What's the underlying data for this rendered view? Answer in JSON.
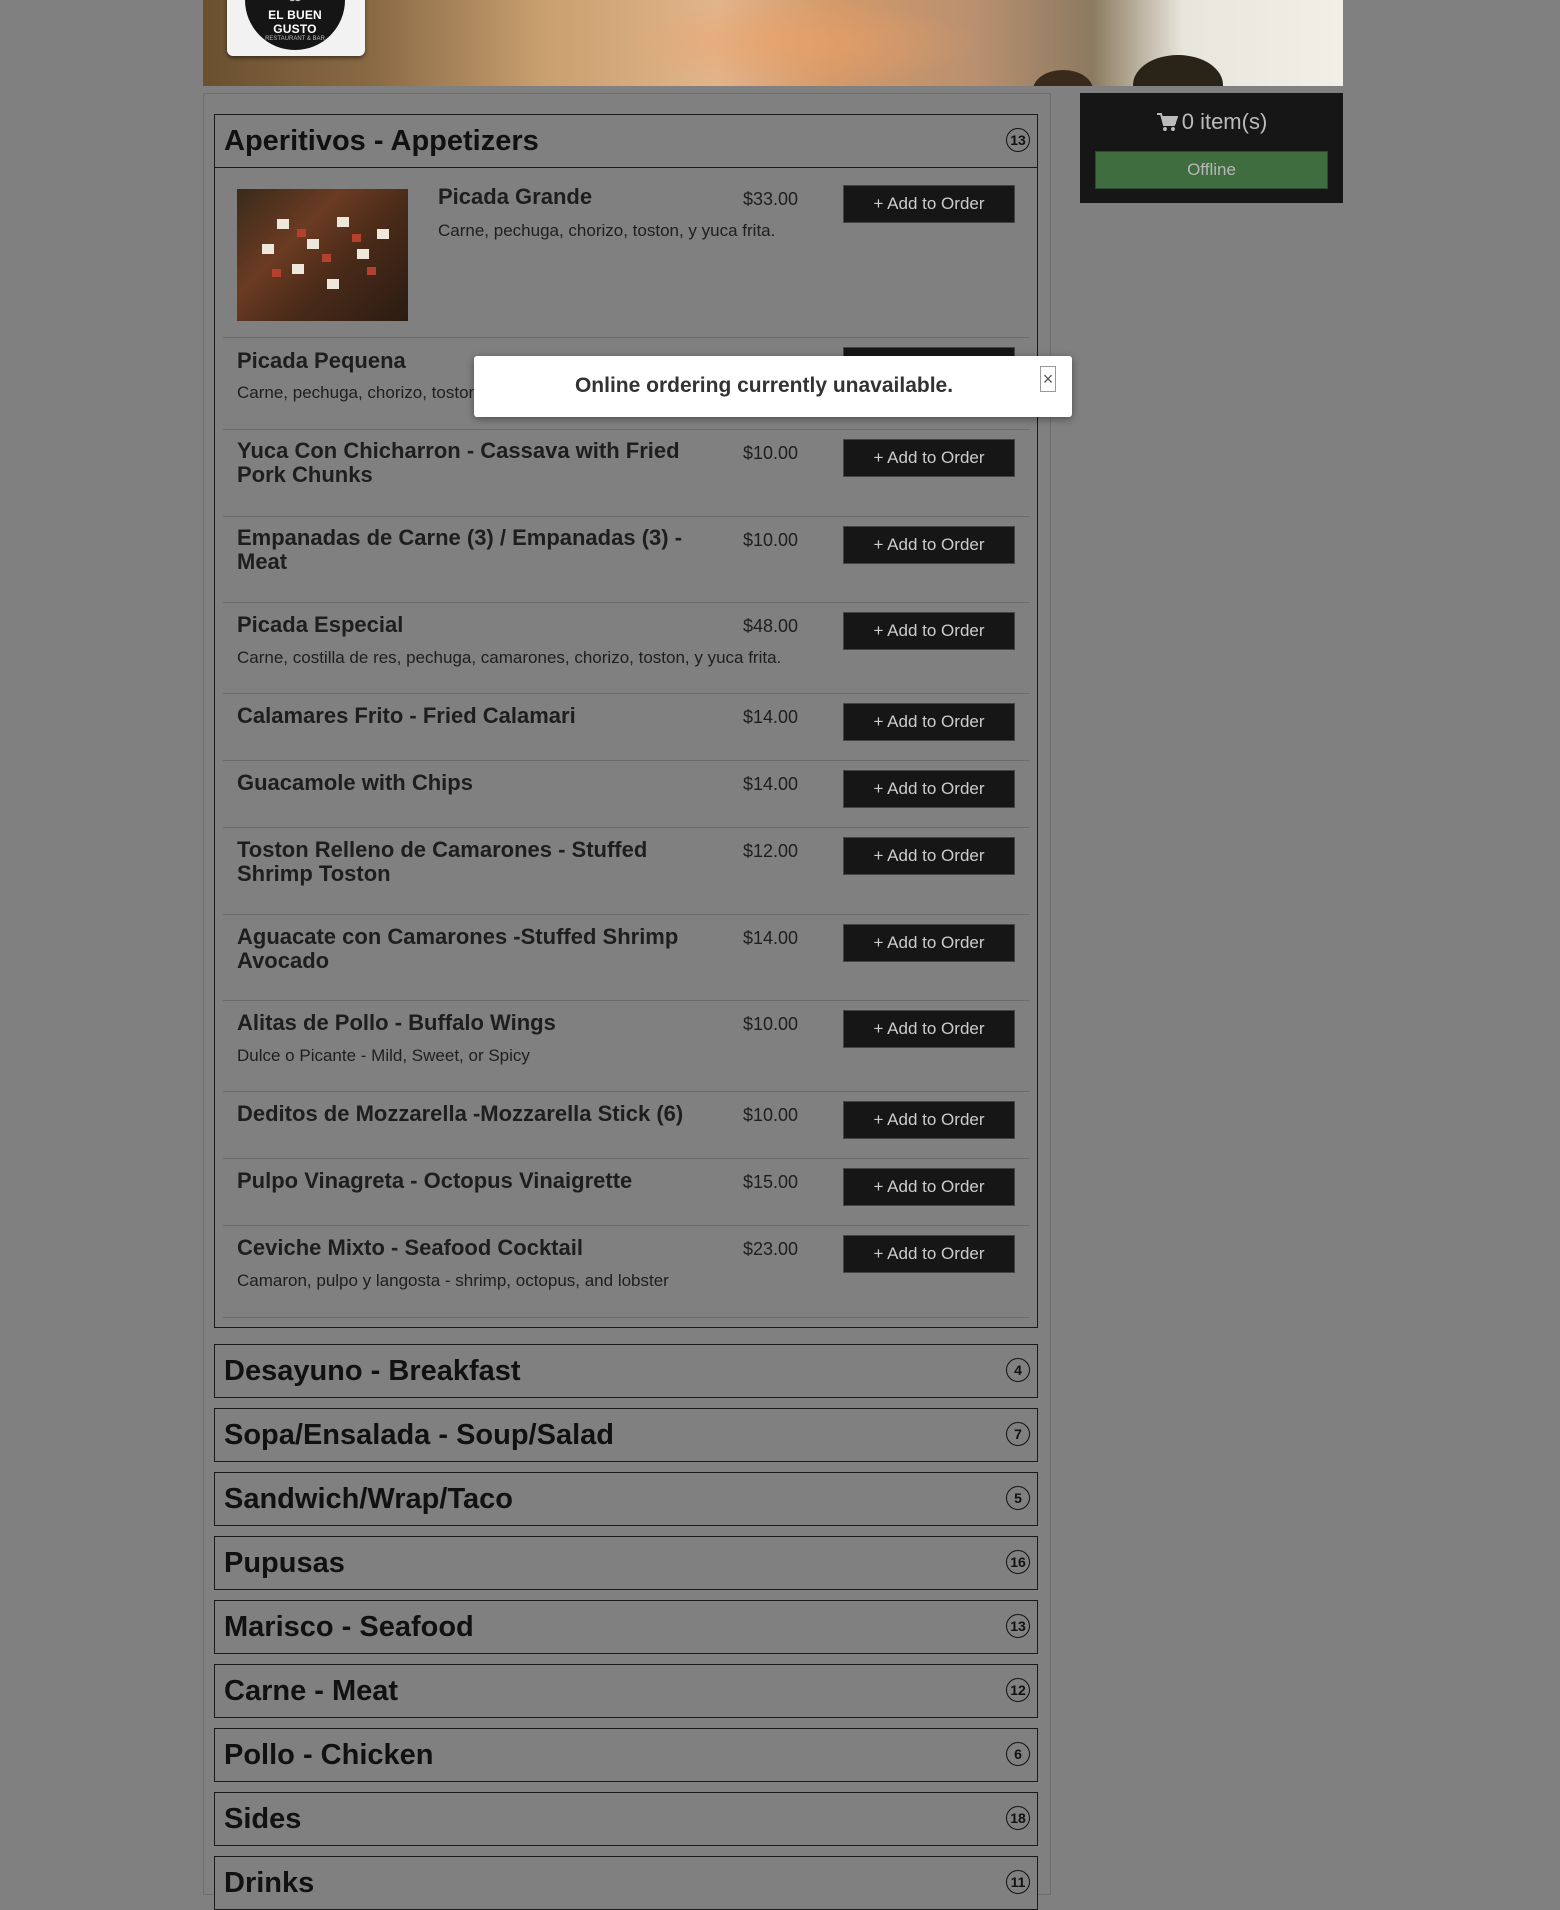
{
  "restaurant": {
    "logo_name": "EL BUEN GUSTO",
    "logo_sub": "RESTAURANT & BAR"
  },
  "cart": {
    "count_text": "0 item(s)",
    "status_button": "Offline"
  },
  "modal": {
    "message": "Online ordering currently unavailable.",
    "close_label": "×"
  },
  "add_label": "+ Add to Order",
  "categories": [
    {
      "title": "Aperitivos - Appetizers",
      "count": "13"
    },
    {
      "title": "Desayuno - Breakfast",
      "count": "4"
    },
    {
      "title": "Sopa/Ensalada - Soup/Salad",
      "count": "7"
    },
    {
      "title": "Sandwich/Wrap/Taco",
      "count": "5"
    },
    {
      "title": "Pupusas",
      "count": "16"
    },
    {
      "title": "Marisco - Seafood",
      "count": "13"
    },
    {
      "title": "Carne - Meat",
      "count": "12"
    },
    {
      "title": "Pollo - Chicken",
      "count": "6"
    },
    {
      "title": "Sides",
      "count": "18"
    },
    {
      "title": "Drinks",
      "count": "11"
    }
  ],
  "items": [
    {
      "name": "Picada Grande",
      "price": "$33.00",
      "desc": "Carne, pechuga, chorizo, toston, y yuca frita."
    },
    {
      "name": "Picada Pequena",
      "price": "",
      "desc": "Carne, pechuga, chorizo, toston"
    },
    {
      "name": "Yuca Con Chicharron - Cassava with Fried Pork Chunks",
      "price": "$10.00",
      "desc": ""
    },
    {
      "name": "Empanadas de Carne (3) / Empanadas (3) - Meat",
      "price": "$10.00",
      "desc": ""
    },
    {
      "name": "Picada Especial",
      "price": "$48.00",
      "desc": "Carne, costilla de res, pechuga, camarones, chorizo, toston, y yuca frita."
    },
    {
      "name": "Calamares Frito - Fried Calamari",
      "price": "$14.00",
      "desc": ""
    },
    {
      "name": "Guacamole with Chips",
      "price": "$14.00",
      "desc": ""
    },
    {
      "name": "Toston Relleno de Camarones - Stuffed Shrimp Toston",
      "price": "$12.00",
      "desc": ""
    },
    {
      "name": "Aguacate con Camarones -Stuffed Shrimp Avocado",
      "price": "$14.00",
      "desc": ""
    },
    {
      "name": "Alitas de Pollo - Buffalo Wings",
      "price": "$10.00",
      "desc": "Dulce o Picante - Mild, Sweet, or Spicy"
    },
    {
      "name": "Deditos de Mozzarella -Mozzarella Stick (6)",
      "price": "$10.00",
      "desc": ""
    },
    {
      "name": "Pulpo Vinagreta - Octopus Vinaigrette",
      "price": "$15.00",
      "desc": ""
    },
    {
      "name": "Ceviche Mixto - Seafood Cocktail",
      "price": "$23.00",
      "desc": "Camaron, pulpo y langosta - shrimp, octopus, and lobster"
    }
  ]
}
